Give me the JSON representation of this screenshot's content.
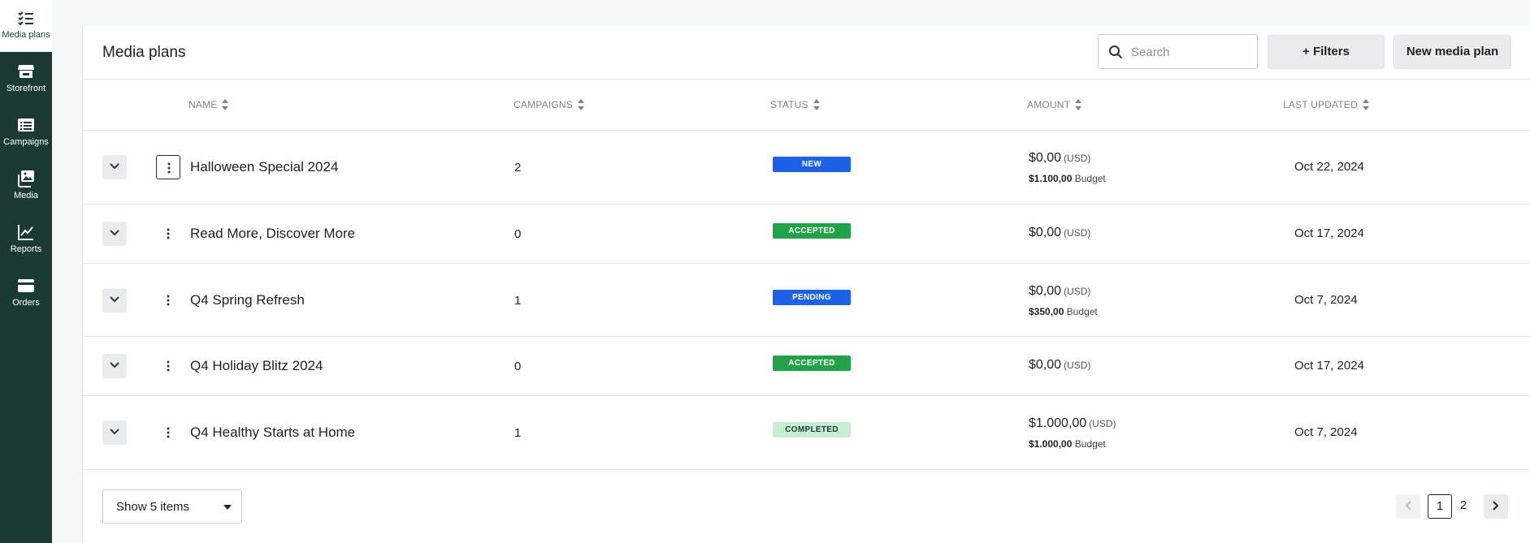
{
  "sidebar": {
    "items": [
      {
        "label": "Media plans",
        "icon": "checklist-icon",
        "active": true
      },
      {
        "label": "Storefront",
        "icon": "storefront-icon"
      },
      {
        "label": "Campaigns",
        "icon": "list-icon"
      },
      {
        "label": "Media",
        "icon": "image-gallery-icon"
      },
      {
        "label": "Reports",
        "icon": "line-chart-icon"
      },
      {
        "label": "Orders",
        "icon": "credit-card-icon"
      }
    ]
  },
  "header": {
    "title": "Media plans",
    "search_placeholder": "Search",
    "filters_label": "+ Filters",
    "new_plan_label": "New media plan"
  },
  "table": {
    "columns": [
      "NAME",
      "CAMPAIGNS",
      "STATUS",
      "AMOUNT",
      "LAST UPDATED"
    ],
    "rows": [
      {
        "name": "Halloween Special 2024",
        "campaigns": "2",
        "status": "NEW",
        "amount": "$0,00",
        "currency": "(USD)",
        "budget_amount": "$1.100,00",
        "budget_label": "Budget",
        "updated": "Oct 22, 2024"
      },
      {
        "name": "Read More, Discover More",
        "campaigns": "0",
        "status": "ACCEPTED",
        "amount": "$0,00",
        "currency": "(USD)",
        "updated": "Oct 17, 2024"
      },
      {
        "name": "Q4 Spring Refresh",
        "campaigns": "1",
        "status": "PENDING",
        "amount": "$0,00",
        "currency": "(USD)",
        "budget_amount": "$350,00",
        "budget_label": "Budget",
        "updated": "Oct 7, 2024"
      },
      {
        "name": "Q4 Holiday Blitz 2024",
        "campaigns": "0",
        "status": "ACCEPTED",
        "amount": "$0,00",
        "currency": "(USD)",
        "updated": "Oct 17, 2024"
      },
      {
        "name": "Q4 Healthy Starts at Home",
        "campaigns": "1",
        "status": "COMPLETED",
        "amount": "$1.000,00",
        "currency": "(USD)",
        "budget_amount": "$1.000,00",
        "budget_label": "Budget",
        "updated": "Oct 7, 2024"
      }
    ]
  },
  "footer": {
    "show_items_label": "Show 5 items",
    "pages": [
      "1",
      "2"
    ],
    "current_page": "1"
  },
  "colors": {
    "sidebar_bg": "#1b3a34",
    "status_new": "#1d62e6",
    "status_pending": "#1d62e6",
    "status_accepted": "#23a24a",
    "status_completed": "#c9ecd3"
  }
}
